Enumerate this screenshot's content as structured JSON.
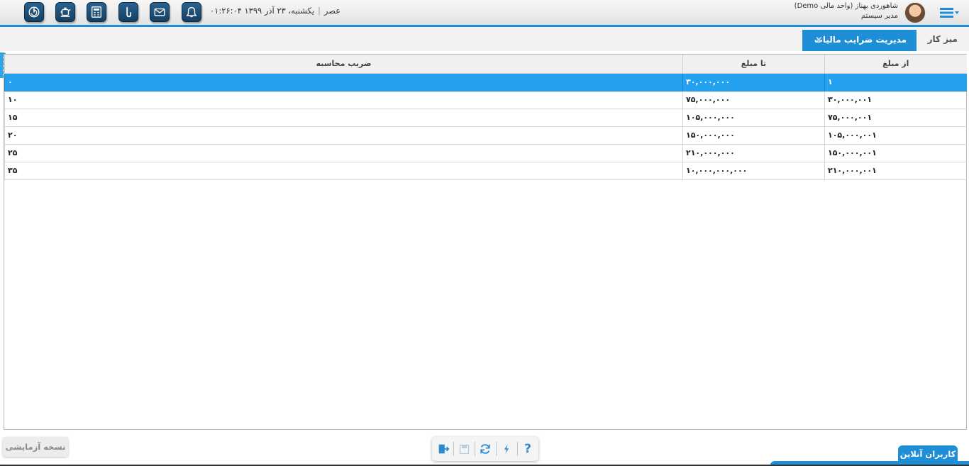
{
  "header": {
    "datetime_date": "یکشنبه، ۲۳ آذر ۱۳۹۹",
    "datetime_time": "۰۱:۲۶:۰۴ عصر",
    "user_name": "شاهوردی بهناز (واحد مالی Demo)",
    "user_role": "مدیر سیستم",
    "toolbar_icons": [
      "power-icon",
      "teapot-icon",
      "calculator-icon",
      "help-hook-icon",
      "mail-icon",
      "bell-icon"
    ]
  },
  "tabs": {
    "desk_label": "میز کار",
    "active_label": "مدیریت ضرایب مالیات",
    "close_glyph": "×"
  },
  "grid": {
    "columns": [
      "از مبلغ",
      "تا مبلغ",
      "ضریب محاسبه"
    ],
    "rows": [
      {
        "from": "۱",
        "to": "۳۰,۰۰۰,۰۰۰",
        "rate": "۰"
      },
      {
        "from": "۳۰,۰۰۰,۰۰۱",
        "to": "۷۵,۰۰۰,۰۰۰",
        "rate": "۱۰"
      },
      {
        "from": "۷۵,۰۰۰,۰۰۱",
        "to": "۱۰۵,۰۰۰,۰۰۰",
        "rate": "۱۵"
      },
      {
        "from": "۱۰۵,۰۰۰,۰۰۱",
        "to": "۱۵۰,۰۰۰,۰۰۰",
        "rate": "۲۰"
      },
      {
        "from": "۱۵۰,۰۰۰,۰۰۱",
        "to": "۲۱۰,۰۰۰,۰۰۰",
        "rate": "۲۵"
      },
      {
        "from": "۲۱۰,۰۰۰,۰۰۱",
        "to": "۱۰,۰۰۰,۰۰۰,۰۰۰",
        "rate": "۳۵"
      }
    ],
    "selected_row": 0
  },
  "footer": {
    "trial_label": "نسخه آزمایشی",
    "online_users_label": "کاربران آنلاین",
    "tools": [
      "exit-icon",
      "save-icon",
      "refresh-icon",
      "flash-icon",
      "help-icon"
    ],
    "help_glyph": "?"
  },
  "colors": {
    "accent": "#1e8fd6",
    "selected_row": "#23a0ee",
    "toolbar_button": "#1f4f78"
  }
}
